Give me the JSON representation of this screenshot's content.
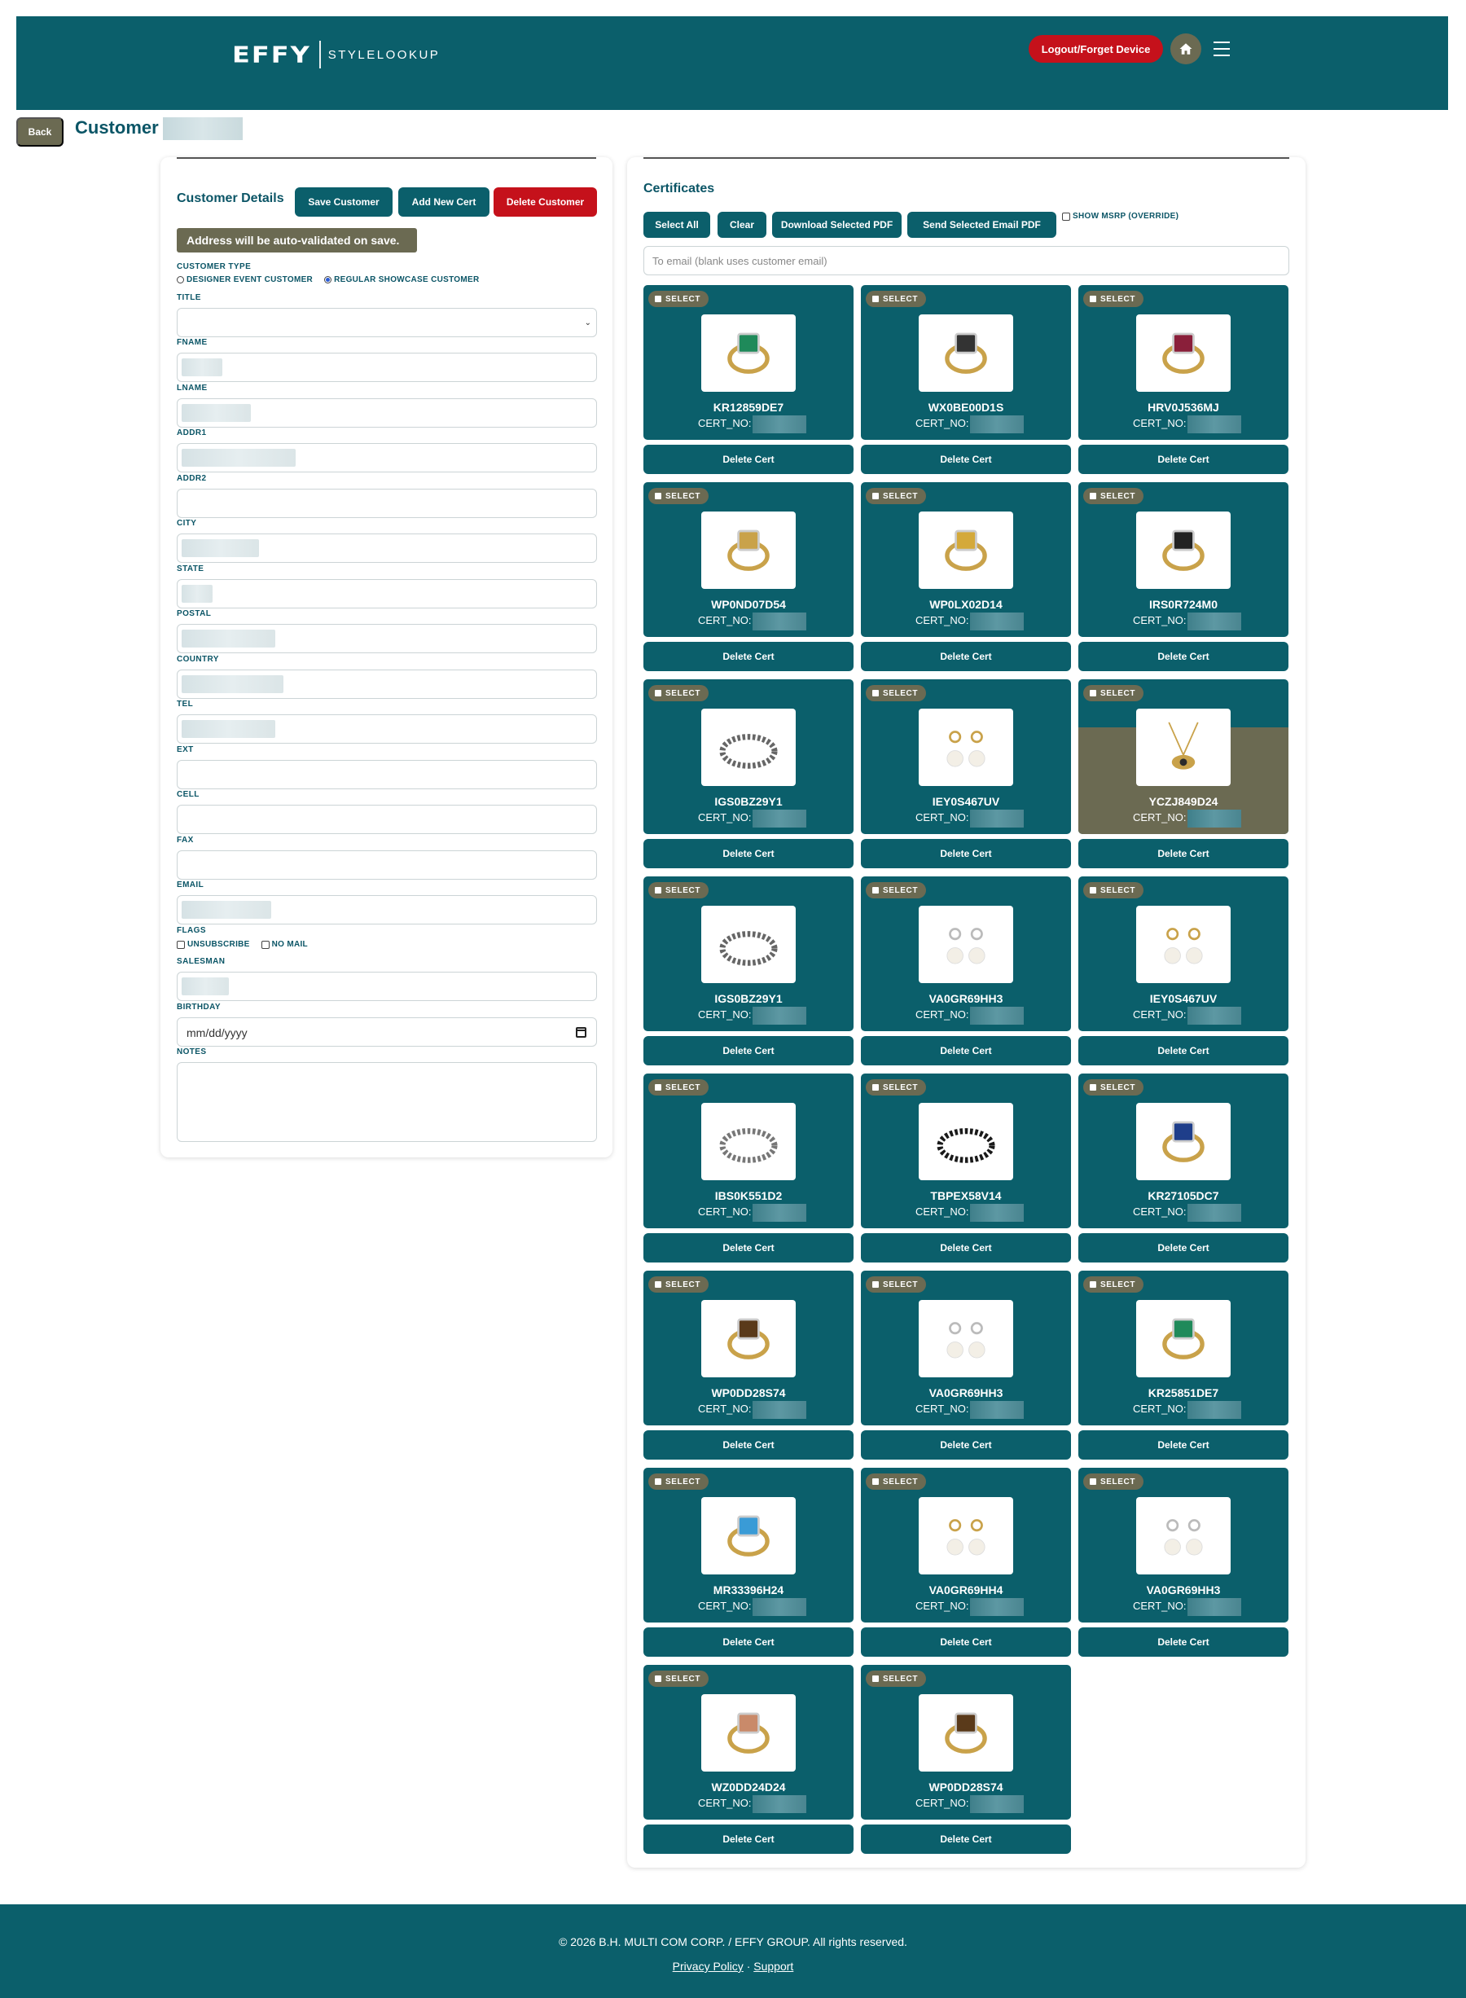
{
  "header": {
    "logo_mark": "EFFY",
    "logo_text": "STYLELOOKUP",
    "logout_label": "Logout/Forget Device",
    "home_icon": "home-icon",
    "menu_icon": "hamburger-menu-icon"
  },
  "page": {
    "back_label": "Back",
    "title": "Customer"
  },
  "customer": {
    "heading": "Customer Details",
    "save_label": "Save Customer",
    "add_cert_label": "Add New Cert",
    "delete_label": "Delete Customer",
    "notice": "Address will be auto-validated on save.",
    "customer_type_label": "CUSTOMER TYPE",
    "type_options": [
      "DESIGNER EVENT CUSTOMER",
      "REGULAR SHOWCASE CUSTOMER"
    ],
    "type_selected": "REGULAR SHOWCASE CUSTOMER",
    "title_label": "TITLE",
    "fname_label": "FNAME",
    "lname_label": "LNAME",
    "addr1_label": "ADDR1",
    "addr2_label": "ADDR2",
    "city_label": "CITY",
    "state_label": "STATE",
    "postal_label": "POSTAL",
    "country_label": "COUNTRY",
    "tel_label": "TEL",
    "ext_label": "EXT",
    "cell_label": "CELL",
    "fax_label": "FAX",
    "email_label": "EMAIL",
    "flags_label": "FLAGS",
    "flag_options": [
      "UNSUBSCRIBE",
      "NO MAIL"
    ],
    "salesman_label": "SALESMAN",
    "birthday_label": "BIRTHDAY",
    "birthday_placeholder": "mm/dd/yyyy",
    "notes_label": "NOTES"
  },
  "certificates": {
    "heading": "Certificates",
    "select_all_label": "Select All",
    "clear_label": "Clear",
    "download_label": "Download Selected PDF",
    "send_label": "Send Selected Email PDF",
    "msrp_label": "SHOW MSRP (OVERRIDE)",
    "email_placeholder": "To email (blank uses customer email)",
    "select_label": "SELECT",
    "cert_no_label": "CERT_NO:",
    "delete_cert_label": "Delete Cert",
    "items": [
      {
        "sku": "KR12859DE7",
        "icon": "emerald-ring-icon",
        "color": "#1f8a5a"
      },
      {
        "sku": "WX0BE00D1S",
        "icon": "black-diamond-ring-icon",
        "color": "#333333"
      },
      {
        "sku": "HRV0J536MJ",
        "icon": "ruby-ring-icon",
        "color": "#8a1f3a"
      },
      {
        "sku": "WP0ND07D54",
        "icon": "crossover-ring-icon",
        "color": "#c9a24a"
      },
      {
        "sku": "WP0LX02D14",
        "icon": "gold-band-ring-icon",
        "color": "#d4a93a"
      },
      {
        "sku": "IRS0R724M0",
        "icon": "panther-ring-icon",
        "color": "#222222"
      },
      {
        "sku": "IGS0BZ29Y1",
        "icon": "bangle-bracelet-icon",
        "color": "#666666"
      },
      {
        "sku": "IEY0S467UV",
        "icon": "pearl-earrings-icon",
        "color": "#c9a24a"
      },
      {
        "sku": "YCZJ849D24",
        "icon": "evil-eye-pendant-icon",
        "color": "#2b2b2b"
      },
      {
        "sku": "IGS0BZ29Y1",
        "icon": "bangle-bracelet-icon",
        "color": "#666666"
      },
      {
        "sku": "VA0GR69HH3",
        "icon": "stud-earrings-icon",
        "color": "#bbbbbb"
      },
      {
        "sku": "IEY0S467UV",
        "icon": "pearl-earrings-icon",
        "color": "#c9a24a"
      },
      {
        "sku": "IBS0K551D2",
        "icon": "chain-bracelet-icon",
        "color": "#777777"
      },
      {
        "sku": "TBPEX58V14",
        "icon": "cord-bracelet-icon",
        "color": "#1a1a1a"
      },
      {
        "sku": "KR27105DC7",
        "icon": "sapphire-ring-icon",
        "color": "#1f3e8a"
      },
      {
        "sku": "WP0DD28S74",
        "icon": "opal-ring-icon",
        "color": "#5a3a1a"
      },
      {
        "sku": "VA0GR69HH3",
        "icon": "stud-earrings-icon",
        "color": "#bbbbbb"
      },
      {
        "sku": "KR25851DE7",
        "icon": "emerald-ring-icon",
        "color": "#1f8a5a"
      },
      {
        "sku": "MR33396H24",
        "icon": "topaz-ring-icon",
        "color": "#3a9bd6"
      },
      {
        "sku": "VA0GR69HH4",
        "icon": "stud-earrings-icon",
        "color": "#c9a24a"
      },
      {
        "sku": "VA0GR69HH3",
        "icon": "stud-earrings-icon",
        "color": "#bbbbbb"
      },
      {
        "sku": "WZ0DD24D24",
        "icon": "leopard-ring-icon",
        "color": "#c98a6a"
      },
      {
        "sku": "WP0DD28S74",
        "icon": "opal-ring-icon",
        "color": "#5a3a1a"
      }
    ]
  },
  "footer": {
    "copyright": "© 2026 B.H. MULTI COM CORP. / EFFY GROUP. All rights reserved.",
    "privacy_label": "Privacy Policy",
    "separator": "·",
    "support_label": "Support"
  }
}
